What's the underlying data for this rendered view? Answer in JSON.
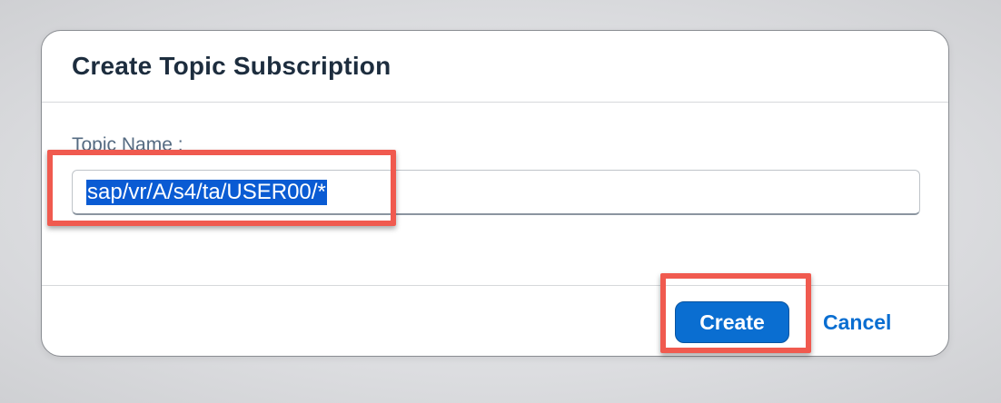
{
  "dialog": {
    "title": "Create Topic Subscription",
    "field_label": "Topic Name :",
    "topic_value": "sap/vr/A/s4/ta/USER00/*",
    "create_label": "Create",
    "cancel_label": "Cancel"
  },
  "colors": {
    "primary_button": "#0a6ed1",
    "link": "#0a6ed1",
    "selection_highlight": "#0a5bd3",
    "annotation_red": "#f05a4f",
    "title_text": "#1d2d3e",
    "label_text": "#556b82"
  }
}
